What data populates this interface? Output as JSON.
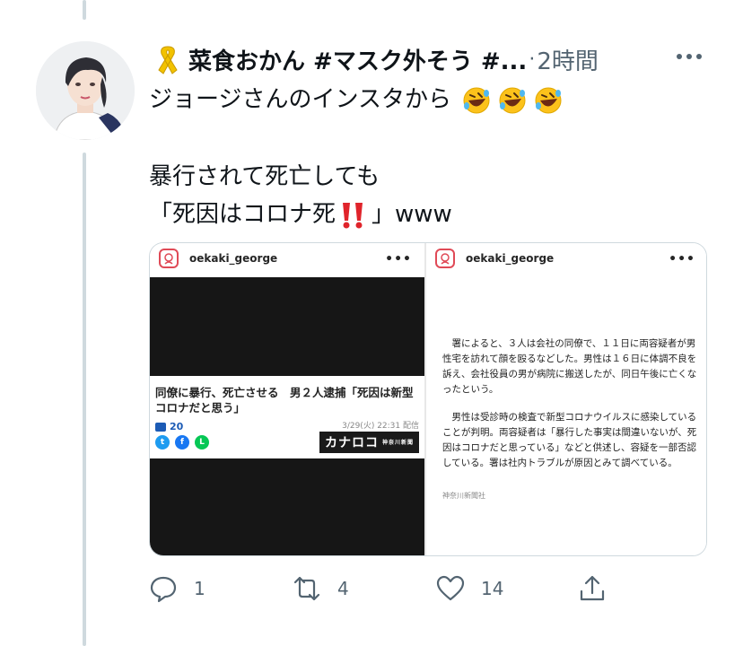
{
  "tweet": {
    "display_name": "菜食おかん #マスク外そう #...",
    "separator": "·",
    "time": "2時間",
    "text_line1": "ジョージさんのインスタから",
    "text_line2": "暴行されて死亡しても",
    "text_line3_start": "「死因はコロナ死",
    "text_line3_end": "」www"
  },
  "media": {
    "left": {
      "username": "oekaki_george",
      "more": "•••",
      "headline": "同僚に暴行、死亡させる　男２人逮捕「死因は新型コロナだと思う」",
      "comment_count": "20",
      "date": "3/29(火) 22:31 配信",
      "brand": "カナロコ",
      "brand_sub": "神奈川新聞"
    },
    "right": {
      "username": "oekaki_george",
      "more": "•••",
      "para1": "　署によると、３人は会社の同僚で、１１日に両容疑者が男性宅を訪れて顔を殴るなどした。男性は１６日に体調不良を訴え、会社役員の男が病院に搬送したが、同日午後に亡くなったという。",
      "para2": "　男性は受診時の検査で新型コロナウイルスに感染していることが判明。両容疑者は「暴行した事実は間違いないが、死因はコロナだと思っている」などと供述し、容疑を一部否認している。署は社内トラブルが原因とみて調べている。",
      "source": "神奈川新聞社"
    }
  },
  "actions": {
    "reply_count": "1",
    "retweet_count": "4",
    "like_count": "14"
  },
  "icons": {
    "ribbon": "yellow-ribbon-icon",
    "laugh": "rolling-on-floor-laughing-icon",
    "bang": "double-exclamation-icon",
    "reply": "reply-icon",
    "retweet": "retweet-icon",
    "like": "heart-icon",
    "share": "share-icon"
  },
  "colors": {
    "text": "#0f1419",
    "secondary": "#536471",
    "thread_line": "#cfd9de",
    "ribbon": "#f2c200",
    "exclamation": "#e0242b"
  }
}
